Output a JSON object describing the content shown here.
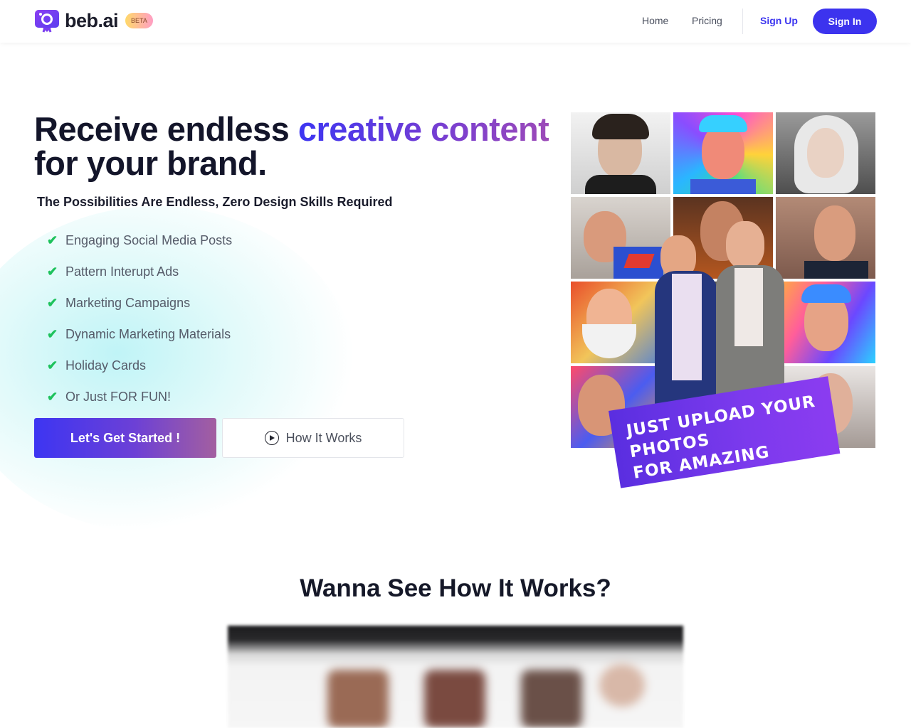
{
  "header": {
    "logo_text": "beb.ai",
    "badge": "BETA",
    "nav": [
      "Home",
      "Pricing"
    ],
    "sign_up": "Sign Up",
    "sign_in": "Sign In"
  },
  "hero": {
    "title_start": "Receive endless ",
    "title_highlight": "creative content",
    "title_end": "for your brand.",
    "subtitle": "The Possibilities Are Endless, Zero Design Skills Required",
    "features": [
      "Engaging Social Media Posts",
      "Pattern Interupt Ads",
      "Marketing Campaigns",
      "Dynamic Marketing Materials",
      "Holiday Cards",
      "Or Just FOR FUN!"
    ],
    "cta_primary": "Let's Get Started !",
    "cta_secondary": "How It Works",
    "banner_line1": "JUST UPLOAD YOUR PHOTOS",
    "banner_line2": "FOR AMAZING RESULTS"
  },
  "section2": {
    "title": "Wanna See How It Works?"
  },
  "colors": {
    "brand": "#3c33ee",
    "gradient_end": "#a35fa0",
    "check": "#1ec25c",
    "banner": "#7c3aed"
  },
  "icons": [
    "logo-icon",
    "check-icon",
    "play-icon"
  ]
}
